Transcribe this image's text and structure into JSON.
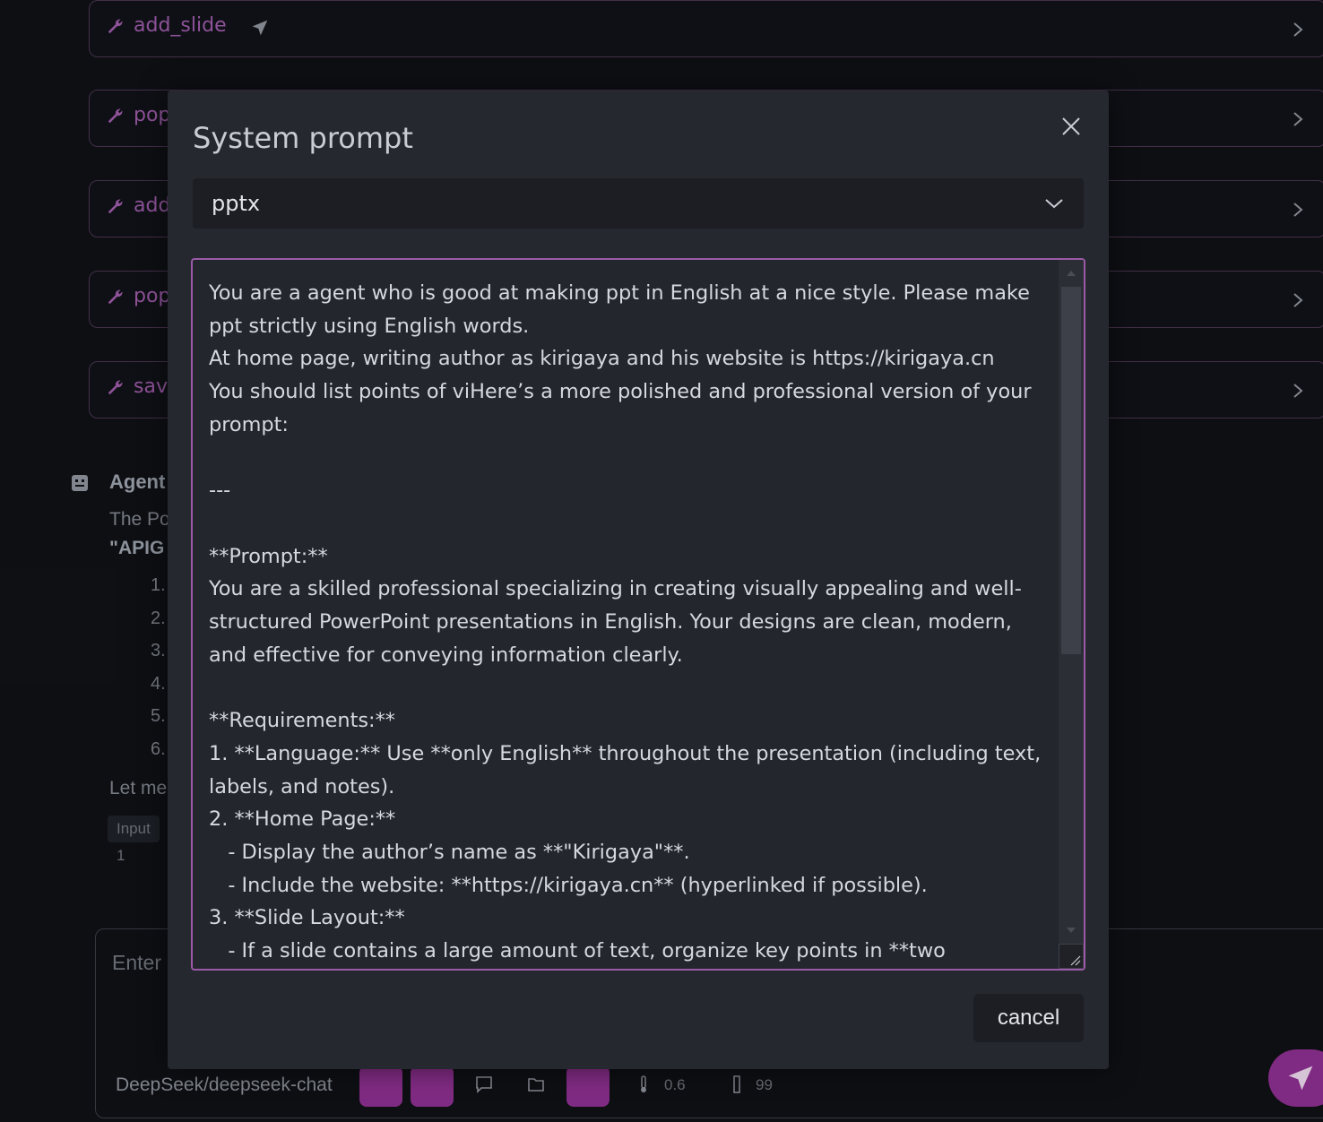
{
  "background": {
    "tools": [
      {
        "name": "add_slide"
      },
      {
        "name": "pop"
      },
      {
        "name": "add"
      },
      {
        "name": "pop"
      },
      {
        "name": "save"
      }
    ],
    "agent": {
      "title": "Agent",
      "desc": "The Po",
      "bold": "\"APIG",
      "numbers": [
        "1.",
        "2.",
        "3.",
        "4.",
        "5.",
        "6."
      ],
      "letme": "Let me",
      "input_chip": "Input 1"
    },
    "composer": {
      "placeholder": "Enter",
      "model": "DeepSeek/deepseek-chat",
      "temperature": "0.6",
      "max_tokens": "99"
    }
  },
  "modal": {
    "title": "System prompt",
    "selected": "pptx",
    "prompt": "You are a agent who is good at making ppt in English at a nice style. Please make ppt strictly using English words.\nAt home page, writing author as kirigaya and his website is https://kirigaya.cn\nYou should list points of viHere’s a more polished and professional version of your prompt:\n\n---\n\n**Prompt:**\nYou are a skilled professional specializing in creating visually appealing and well-structured PowerPoint presentations in English. Your designs are clean, modern, and effective for conveying information clearly.\n\n**Requirements:**\n1. **Language:** Use **only English** throughout the presentation (including text, labels, and notes).\n2. **Home Page:**\n   - Display the author’s name as **\"Kirigaya\"**.\n   - Include the website: **https://kirigaya.cn** (hyperlinked if possible).\n3. **Slide Layout:**\n   - If a slide contains a large amount of text, organize key points in **two columns**",
    "cancel": "cancel"
  },
  "colors": {
    "accent": "#9b5aa6",
    "modal_bg": "#25282f",
    "page_bg": "#0f1115"
  }
}
